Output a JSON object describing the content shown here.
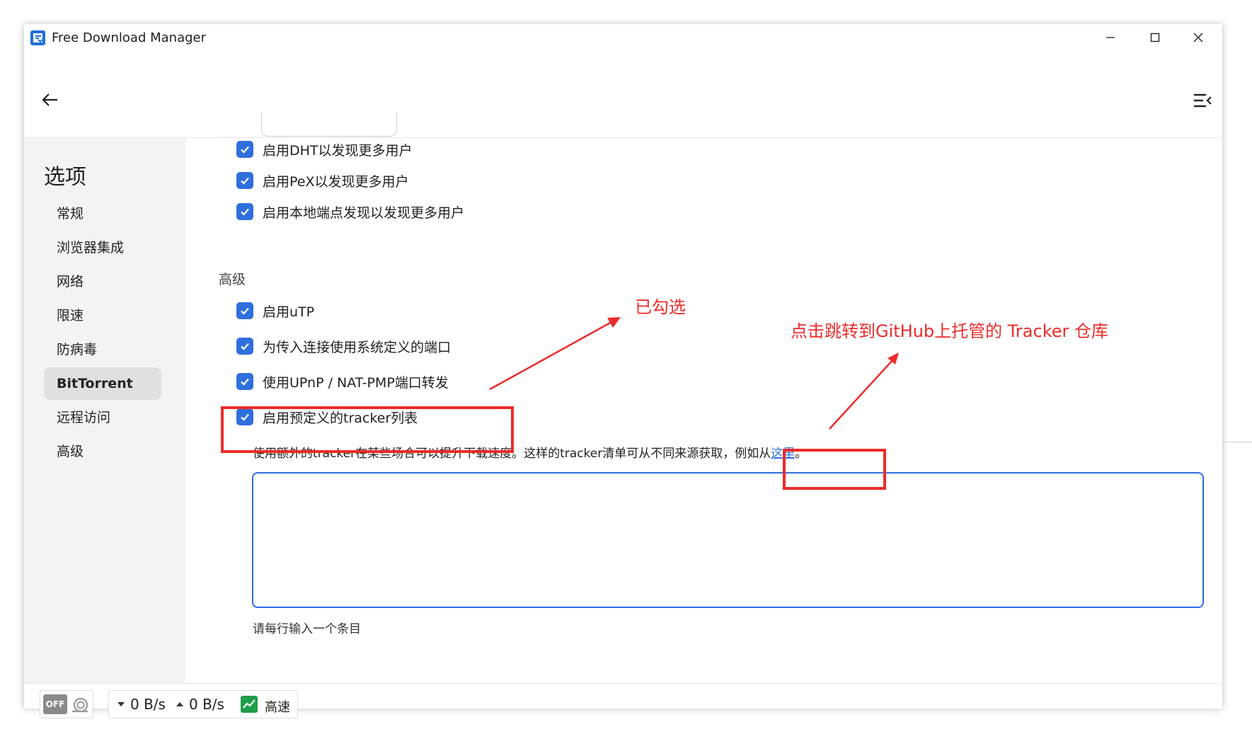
{
  "window": {
    "title": "Free Download Manager",
    "accent": "#2f6fdd"
  },
  "sidebar": {
    "title": "选项",
    "items": [
      {
        "label": "常规"
      },
      {
        "label": "浏览器集成"
      },
      {
        "label": "网络"
      },
      {
        "label": "限速"
      },
      {
        "label": "防病毒"
      },
      {
        "label": "BitTorrent",
        "active": true
      },
      {
        "label": "远程访问"
      },
      {
        "label": "高级"
      }
    ]
  },
  "bittorrent": {
    "checkboxes_top": [
      {
        "label": "启用DHT以发现更多用户",
        "checked": true
      },
      {
        "label": "启用PeX以发现更多用户",
        "checked": true
      },
      {
        "label": "启用本地端点发现以发现更多用户",
        "checked": true
      }
    ],
    "advanced_title": "高级",
    "checkboxes_advanced": [
      {
        "label": "启用uTP",
        "checked": true
      },
      {
        "label": "为传入连接使用系统定义的端口",
        "checked": true
      },
      {
        "label": "使用UPnP / NAT-PMP端口转发",
        "checked": true
      },
      {
        "label": "启用预定义的tracker列表",
        "checked": true
      }
    ],
    "tracker_desc": "使用额外的tracker在某些场合可以提升下载速度。这样的tracker清单可从不同来源获取，例如从",
    "tracker_link": "这里",
    "tracker_desc_end": "。",
    "tracker_input_value": "",
    "tracker_hint": "请每行输入一个条目"
  },
  "statusbar": {
    "toggle_label": "OFF",
    "download_speed": "0 B/s",
    "upload_speed": "0 B/s",
    "mode_label": "高速"
  },
  "annotations": {
    "checked_note": "已勾选",
    "link_note": "点击跳转到GitHub上托管的 Tracker 仓库",
    "color": "#ee2b2b"
  }
}
